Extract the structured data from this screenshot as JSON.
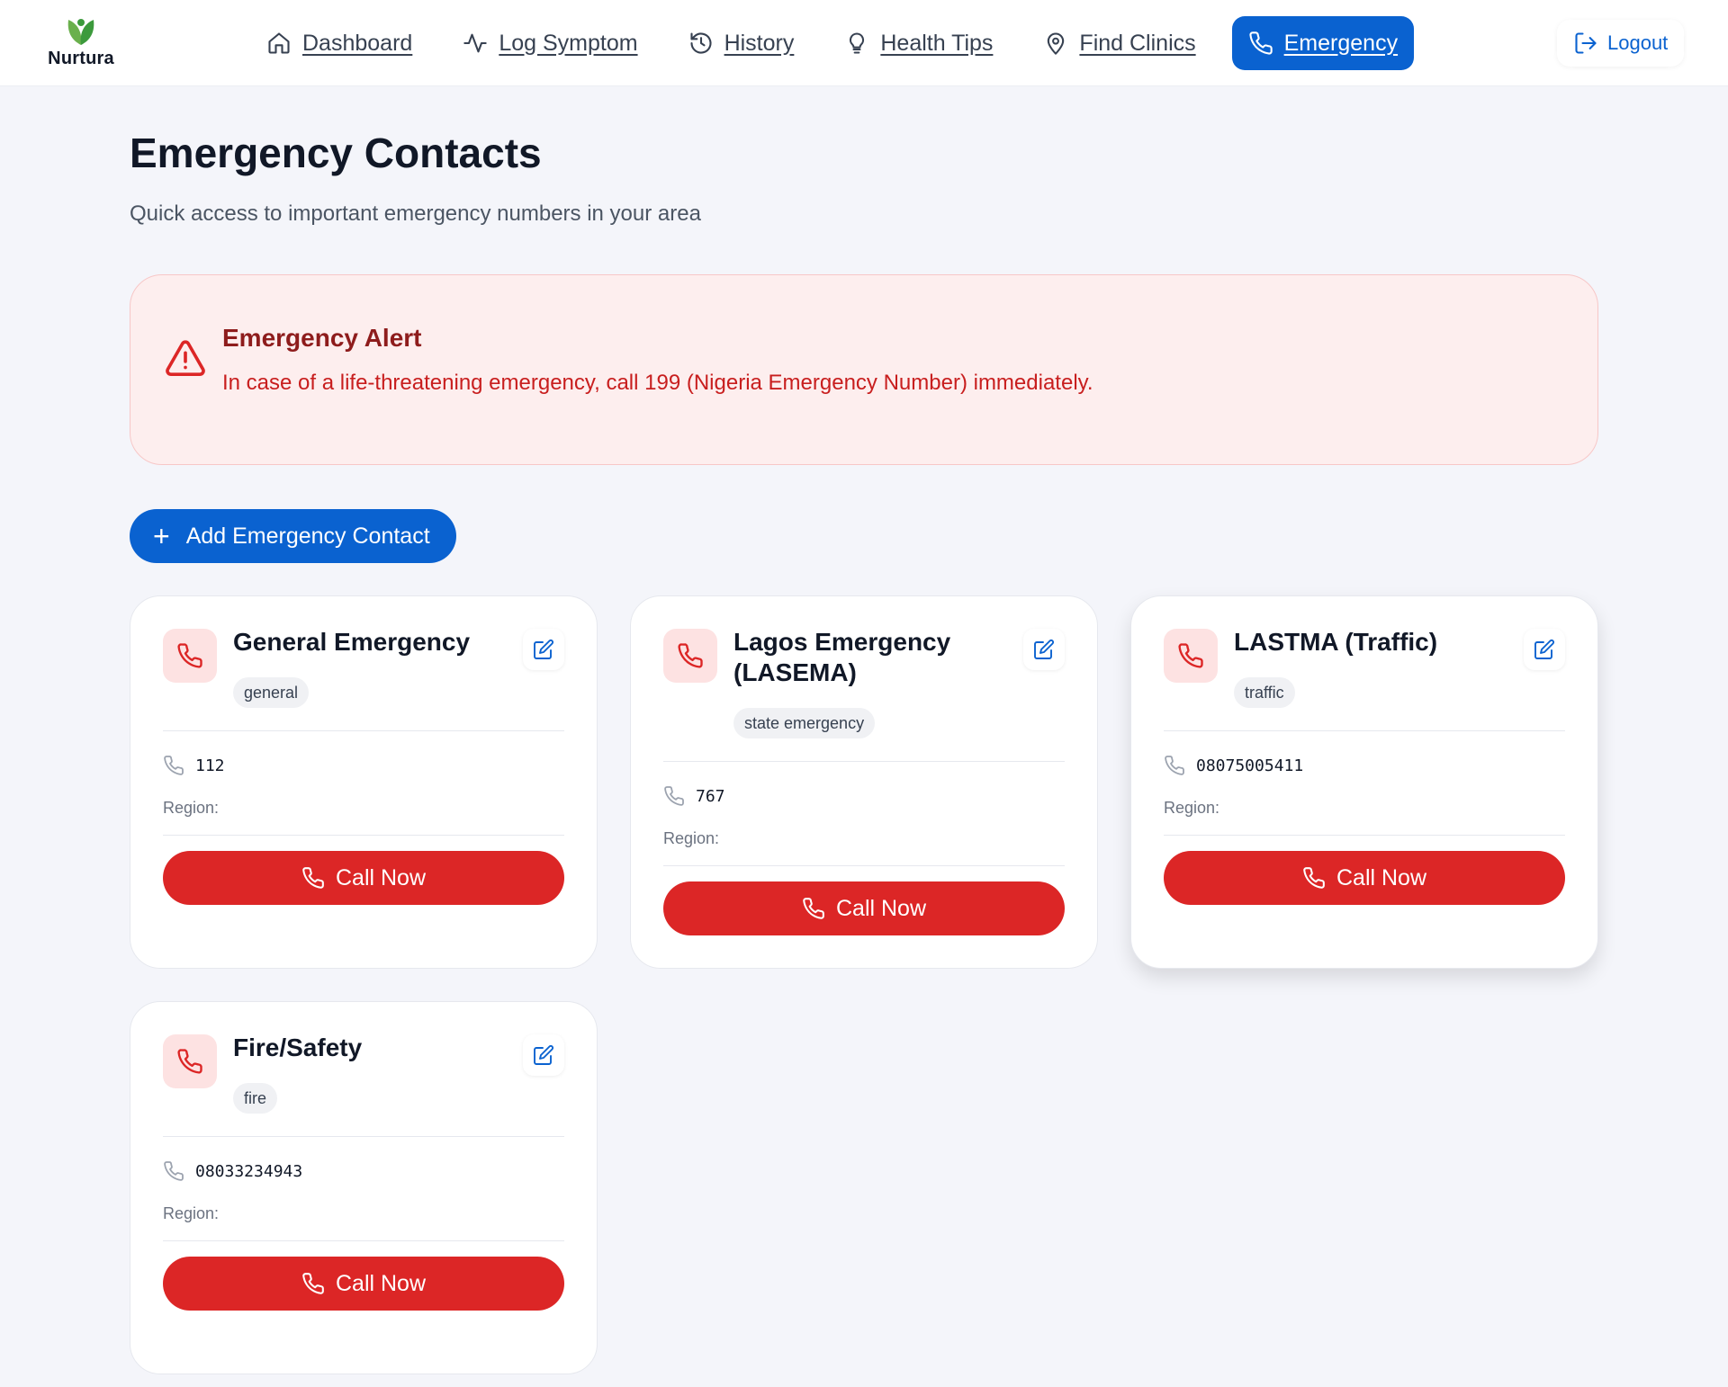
{
  "brand": {
    "name": "Nurtura"
  },
  "nav": {
    "items": [
      {
        "label": "Dashboard",
        "icon": "home-icon"
      },
      {
        "label": "Log Symptom",
        "icon": "activity-icon"
      },
      {
        "label": "History",
        "icon": "history-icon"
      },
      {
        "label": "Health Tips",
        "icon": "lightbulb-icon"
      },
      {
        "label": "Find Clinics",
        "icon": "map-pin-icon"
      },
      {
        "label": "Emergency",
        "icon": "phone-icon",
        "active": true
      }
    ],
    "logout": "Logout"
  },
  "page": {
    "title": "Emergency Contacts",
    "subtitle": "Quick access to important emergency numbers in your area"
  },
  "alert": {
    "title": "Emergency Alert",
    "text": "In case of a life-threatening emergency, call 199 (Nigeria Emergency Number) immediately."
  },
  "add_button": {
    "label": "Add Emergency Contact"
  },
  "contacts": [
    {
      "name": "General Emergency",
      "tag": "general",
      "number": "112",
      "region_label": "Region:",
      "call_label": "Call Now"
    },
    {
      "name": "Lagos Emergency (LASEMA)",
      "tag": "state emergency",
      "number": "767",
      "region_label": "Region:",
      "call_label": "Call Now"
    },
    {
      "name": "LASTMA (Traffic)",
      "tag": "traffic",
      "number": "08075005411",
      "region_label": "Region:",
      "call_label": "Call Now"
    },
    {
      "name": "Fire/Safety",
      "tag": "fire",
      "number": "08033234943",
      "region_label": "Region:",
      "call_label": "Call Now"
    }
  ],
  "colors": {
    "primary": "#0a62d0",
    "danger": "#dc2626",
    "alert_bg": "#fdeeee",
    "page_bg": "#f4f5fa"
  }
}
